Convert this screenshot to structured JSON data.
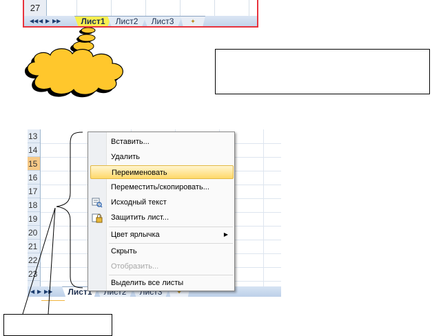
{
  "top_strip": {
    "row_number": "27",
    "nav_arrows": [
      "◀◀",
      "◀",
      "▶",
      "▶▶"
    ],
    "tabs": [
      "Лист1",
      "Лист2",
      "Лист3"
    ]
  },
  "bottom": {
    "row_numbers": [
      "13",
      "14",
      "15",
      "16",
      "17",
      "18",
      "19",
      "20",
      "21",
      "22",
      "23"
    ],
    "selected_row": "15",
    "tabs": [
      "Лист1",
      "Лист2",
      "Лист3"
    ],
    "context_menu": {
      "items": [
        {
          "label": "Вставить...",
          "icon": null,
          "state": "normal"
        },
        {
          "label": "Удалить",
          "icon": null,
          "state": "normal"
        },
        {
          "label": "Переименовать",
          "icon": null,
          "state": "hover"
        },
        {
          "label": "Переместить/скопировать...",
          "icon": null,
          "state": "normal"
        },
        {
          "label": "Исходный текст",
          "icon": "view-code-icon",
          "state": "normal"
        },
        {
          "label": "Защитить лист...",
          "icon": "protect-sheet-icon",
          "state": "normal"
        },
        {
          "label": "Цвет ярлычка",
          "icon": null,
          "state": "submenu"
        },
        {
          "label": "Скрыть",
          "icon": null,
          "state": "normal"
        },
        {
          "label": "Отобразить...",
          "icon": null,
          "state": "disabled"
        },
        {
          "label": "Выделить все листы",
          "icon": null,
          "state": "normal"
        }
      ]
    }
  },
  "colors": {
    "frame_red": "#e8323c",
    "cloud_fill": "#ffc72c",
    "active_tab_yellow": "#f8ef50",
    "menu_hover": "#ffd96a"
  }
}
